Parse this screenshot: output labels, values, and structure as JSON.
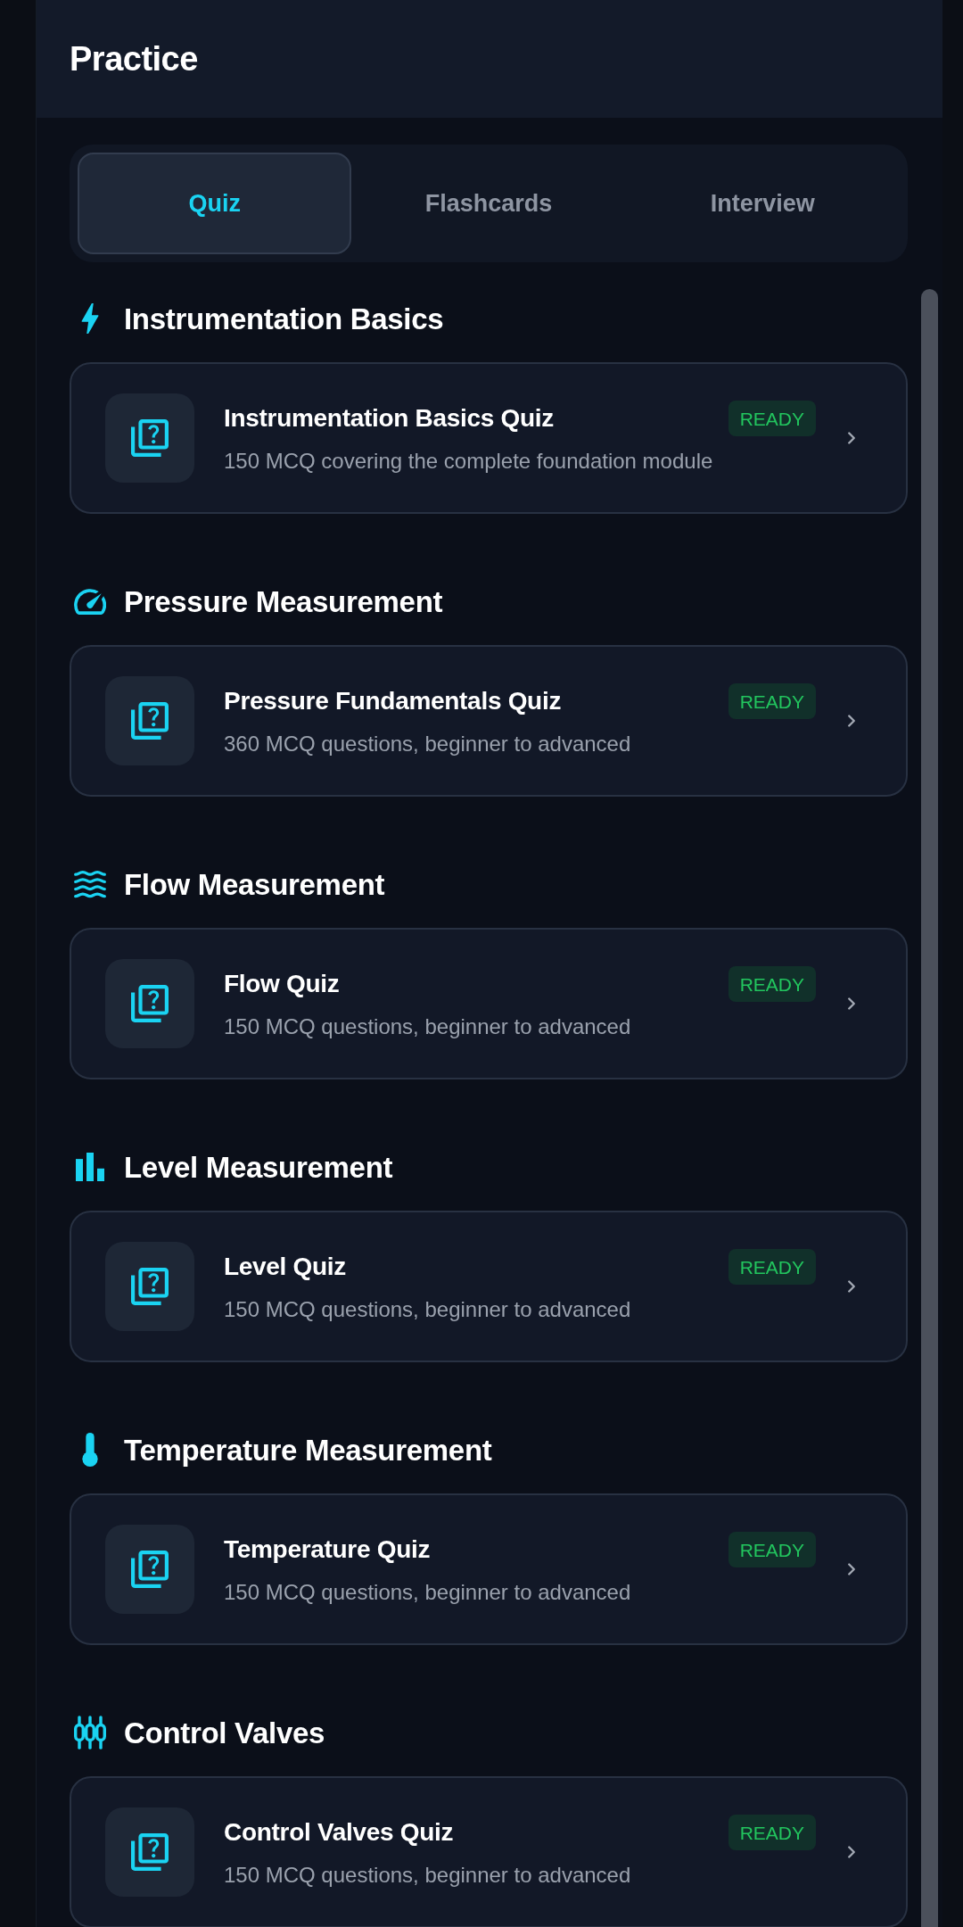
{
  "header": {
    "title": "Practice"
  },
  "tabs": [
    {
      "label": "Quiz",
      "selected": true
    },
    {
      "label": "Flashcards",
      "selected": false
    },
    {
      "label": "Interview",
      "selected": false
    }
  ],
  "sections": [
    {
      "heading": "Instrumentation Basics",
      "quizzes": [
        {
          "title": "Instrumentation Basics Quiz",
          "description": "150 MCQ covering the complete foundation module",
          "badge": "READY"
        }
      ]
    },
    {
      "heading": "Pressure Measurement",
      "quizzes": [
        {
          "title": "Pressure Fundamentals Quiz",
          "description": "360 MCQ questions, beginner to advanced",
          "badge": "READY"
        }
      ]
    },
    {
      "heading": "Flow Measurement",
      "quizzes": [
        {
          "title": "Flow Quiz",
          "description": "150 MCQ questions, beginner to advanced",
          "badge": "READY"
        }
      ]
    },
    {
      "heading": "Level Measurement",
      "quizzes": [
        {
          "title": "Level Quiz",
          "description": "150 MCQ questions, beginner to advanced",
          "badge": "READY"
        }
      ]
    },
    {
      "heading": "Temperature Measurement",
      "quizzes": [
        {
          "title": "Temperature Quiz",
          "description": "150 MCQ questions, beginner to advanced",
          "badge": "READY"
        }
      ]
    },
    {
      "heading": "Control Valves",
      "quizzes": [
        {
          "title": "Control Valves Quiz",
          "description": "150 MCQ questions, beginner to advanced",
          "badge": "READY"
        }
      ]
    }
  ]
}
